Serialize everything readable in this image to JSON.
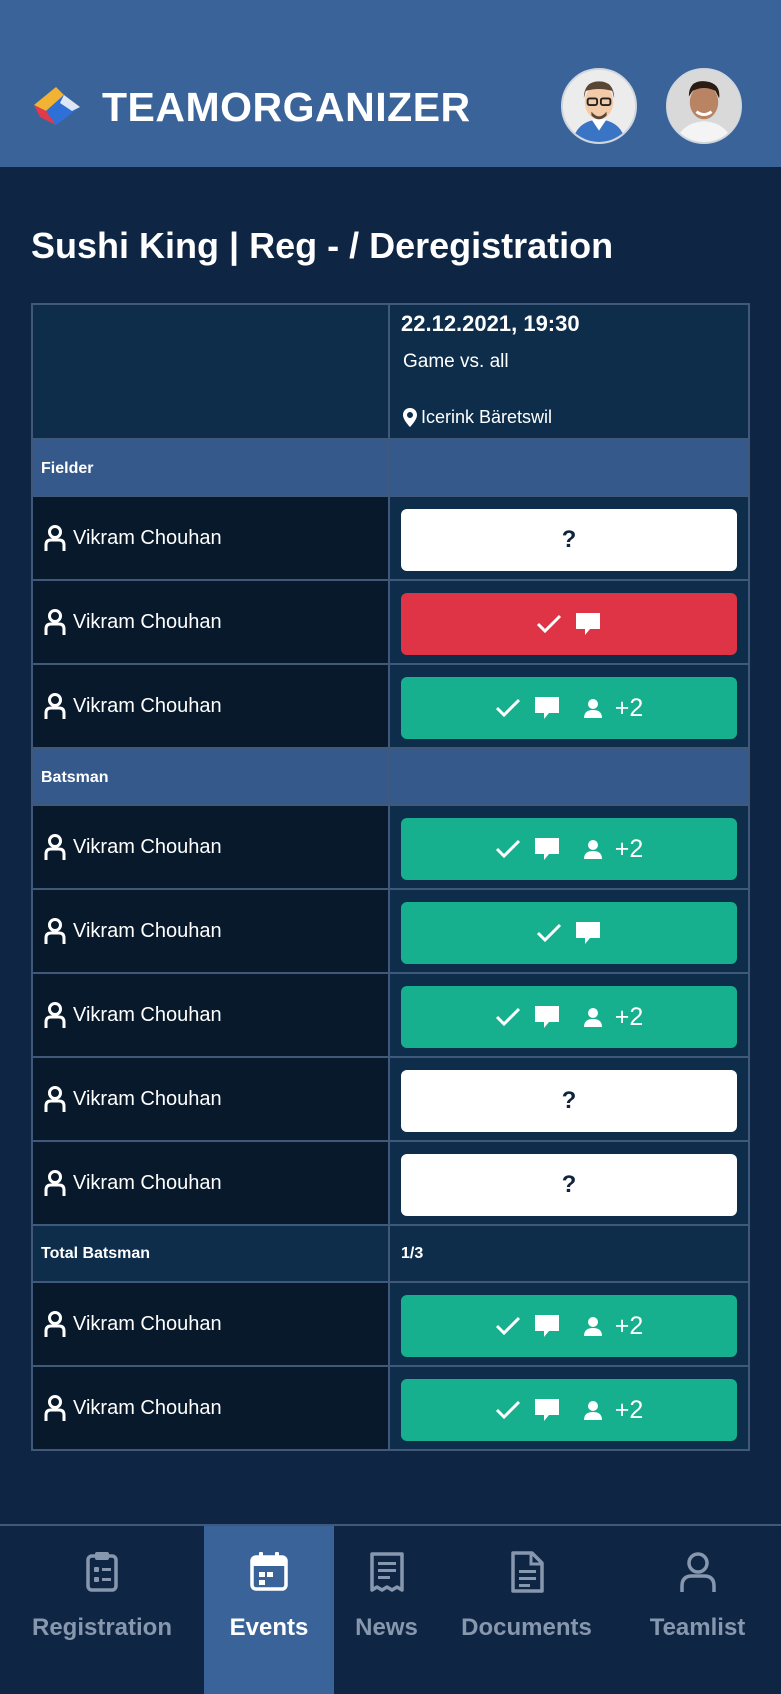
{
  "app": {
    "brand": "TEAMORGANIZER",
    "colors": {
      "header": "#3a6499",
      "background": "#0f2544",
      "accepted": "#16b08e",
      "declined": "#de3446",
      "pending": "#ffffff"
    }
  },
  "page": {
    "title": "Sushi King | Reg - / Deregistration"
  },
  "event": {
    "date": "22.12.2021, 19:30",
    "type": "Game vs. all",
    "location": "Icerink Bäretswil",
    "location_icon": "map-pin-icon"
  },
  "groups": [
    {
      "label": "Fielder",
      "players": [
        {
          "name": "Vikram Chouhan",
          "status": "pending",
          "status_text": "?"
        },
        {
          "name": "Vikram Chouhan",
          "status": "declined",
          "comment": true
        },
        {
          "name": "Vikram Chouhan",
          "status": "accepted",
          "comment": true,
          "guests": "+2"
        }
      ]
    },
    {
      "label": "Batsman",
      "players": [
        {
          "name": "Vikram Chouhan",
          "status": "accepted",
          "comment": true,
          "guests": "+2"
        },
        {
          "name": "Vikram Chouhan",
          "status": "accepted",
          "comment": true
        },
        {
          "name": "Vikram Chouhan",
          "status": "accepted",
          "comment": true,
          "guests": "+2"
        },
        {
          "name": "Vikram Chouhan",
          "status": "pending",
          "status_text": "?"
        },
        {
          "name": "Vikram Chouhan",
          "status": "pending",
          "status_text": "?"
        }
      ],
      "total": {
        "label": "Total Batsman",
        "value": "1/3"
      }
    },
    {
      "label": "",
      "players": [
        {
          "name": "Vikram Chouhan",
          "status": "accepted",
          "comment": true,
          "guests": "+2"
        },
        {
          "name": "Vikram Chouhan",
          "status": "accepted",
          "comment": true,
          "guests": "+2"
        }
      ]
    }
  ],
  "bottom_nav": [
    {
      "label": "Registration",
      "icon": "clipboard-icon",
      "active": false
    },
    {
      "label": "Events",
      "icon": "calendar-icon",
      "active": true
    },
    {
      "label": "News",
      "icon": "news-icon",
      "active": false
    },
    {
      "label": "Documents",
      "icon": "document-icon",
      "active": false
    },
    {
      "label": "Teamlist",
      "icon": "person-icon",
      "active": false
    }
  ]
}
